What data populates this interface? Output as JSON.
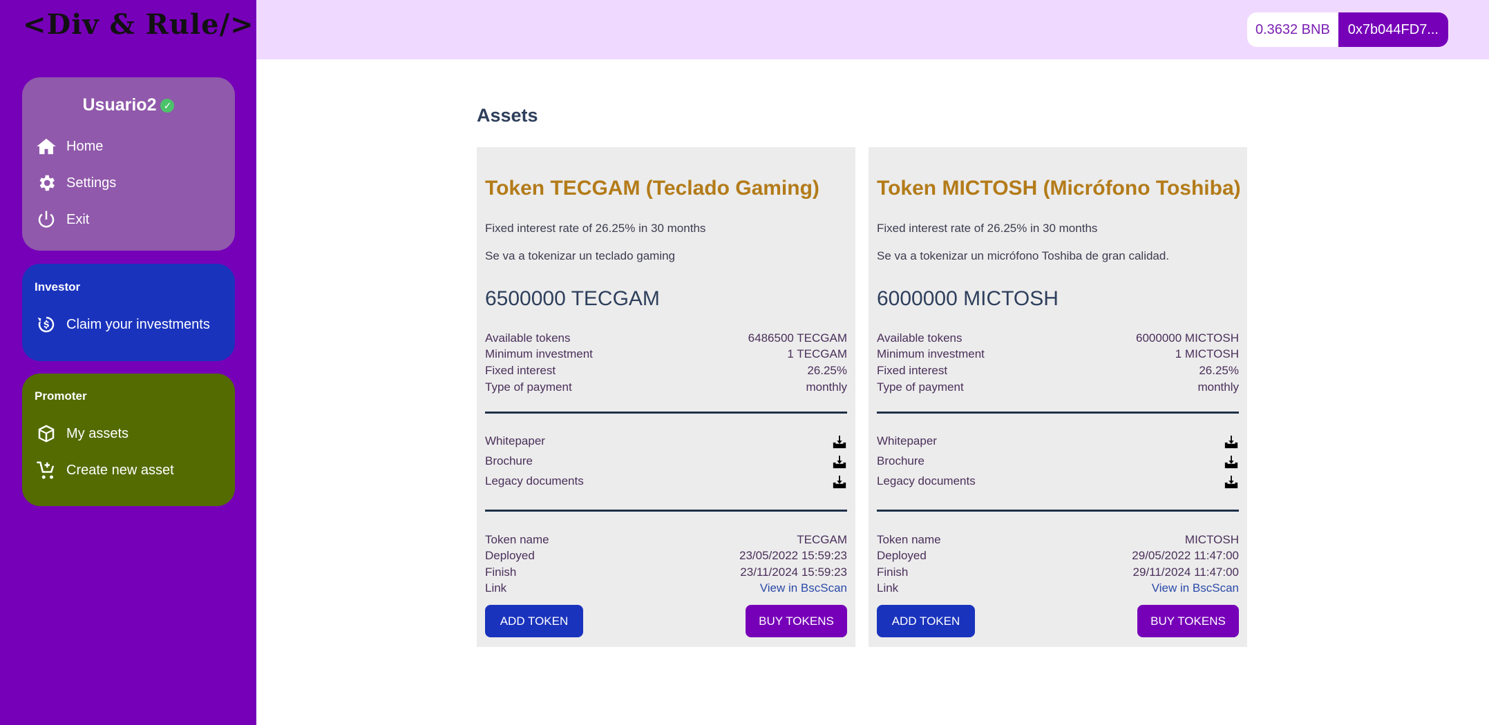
{
  "sidebar": {
    "logo": "<Div & Rule/>",
    "user": {
      "name": "Usuario2",
      "verified_icon": "check-circle-icon",
      "items": [
        {
          "label": "Home",
          "icon": "home-icon"
        },
        {
          "label": "Settings",
          "icon": "gear-icon"
        },
        {
          "label": "Exit",
          "icon": "power-icon"
        }
      ]
    },
    "investor": {
      "title": "Investor",
      "items": [
        {
          "label": "Claim your investments",
          "icon": "dollar-refresh-icon"
        }
      ]
    },
    "promoter": {
      "title": "Promoter",
      "items": [
        {
          "label": "My assets",
          "icon": "box-icon"
        },
        {
          "label": "Create new asset",
          "icon": "cart-plus-icon"
        }
      ]
    }
  },
  "header": {
    "balance": "0.3632 BNB",
    "address": "0x7b044FD7..."
  },
  "main": {
    "title": "Assets",
    "assets": [
      {
        "title": "Token TECGAM (Teclado Gaming)",
        "rate": "Fixed interest rate of 26.25% in 30 months",
        "description": "Se va a tokenizar un teclado gaming",
        "amount": "6500000 TECGAM",
        "details": [
          {
            "label": "Available tokens",
            "value": "6486500 TECGAM"
          },
          {
            "label": "Minimum investment",
            "value": "1 TECGAM"
          },
          {
            "label": "Fixed interest",
            "value": "26.25%"
          },
          {
            "label": "Type of payment",
            "value": "monthly"
          }
        ],
        "documents": [
          "Whitepaper",
          "Brochure",
          "Legacy documents"
        ],
        "info": [
          {
            "label": "Token name",
            "value": "TECGAM"
          },
          {
            "label": "Deployed",
            "value": "23/05/2022 15:59:23"
          },
          {
            "label": "Finish",
            "value": "23/11/2024 15:59:23"
          },
          {
            "label": "Link",
            "value": "View in BscScan"
          }
        ],
        "add_label": "ADD TOKEN",
        "buy_label": "BUY TOKENS"
      },
      {
        "title": "Token MICTOSH (Micrófono Toshiba)",
        "rate": "Fixed interest rate of 26.25% in 30 months",
        "description": "Se va a tokenizar un micrófono Toshiba de gran calidad.",
        "amount": "6000000 MICTOSH",
        "details": [
          {
            "label": "Available tokens",
            "value": "6000000 MICTOSH"
          },
          {
            "label": "Minimum investment",
            "value": "1 MICTOSH"
          },
          {
            "label": "Fixed interest",
            "value": "26.25%"
          },
          {
            "label": "Type of payment",
            "value": "monthly"
          }
        ],
        "documents": [
          "Whitepaper",
          "Brochure",
          "Legacy documents"
        ],
        "info": [
          {
            "label": "Token name",
            "value": "MICTOSH"
          },
          {
            "label": "Deployed",
            "value": "29/05/2022 11:47:00"
          },
          {
            "label": "Finish",
            "value": "29/11/2024 11:47:00"
          },
          {
            "label": "Link",
            "value": "View in BscScan"
          }
        ],
        "add_label": "ADD TOKEN",
        "buy_label": "BUY TOKENS"
      }
    ]
  },
  "colors": {
    "sidebar": "#7600b8",
    "user_card": "#9059ab",
    "investor_card": "#1a33bd",
    "promoter_card": "#536b00",
    "topbar": "#f0d9ff",
    "asset_title": "#b37b19"
  }
}
